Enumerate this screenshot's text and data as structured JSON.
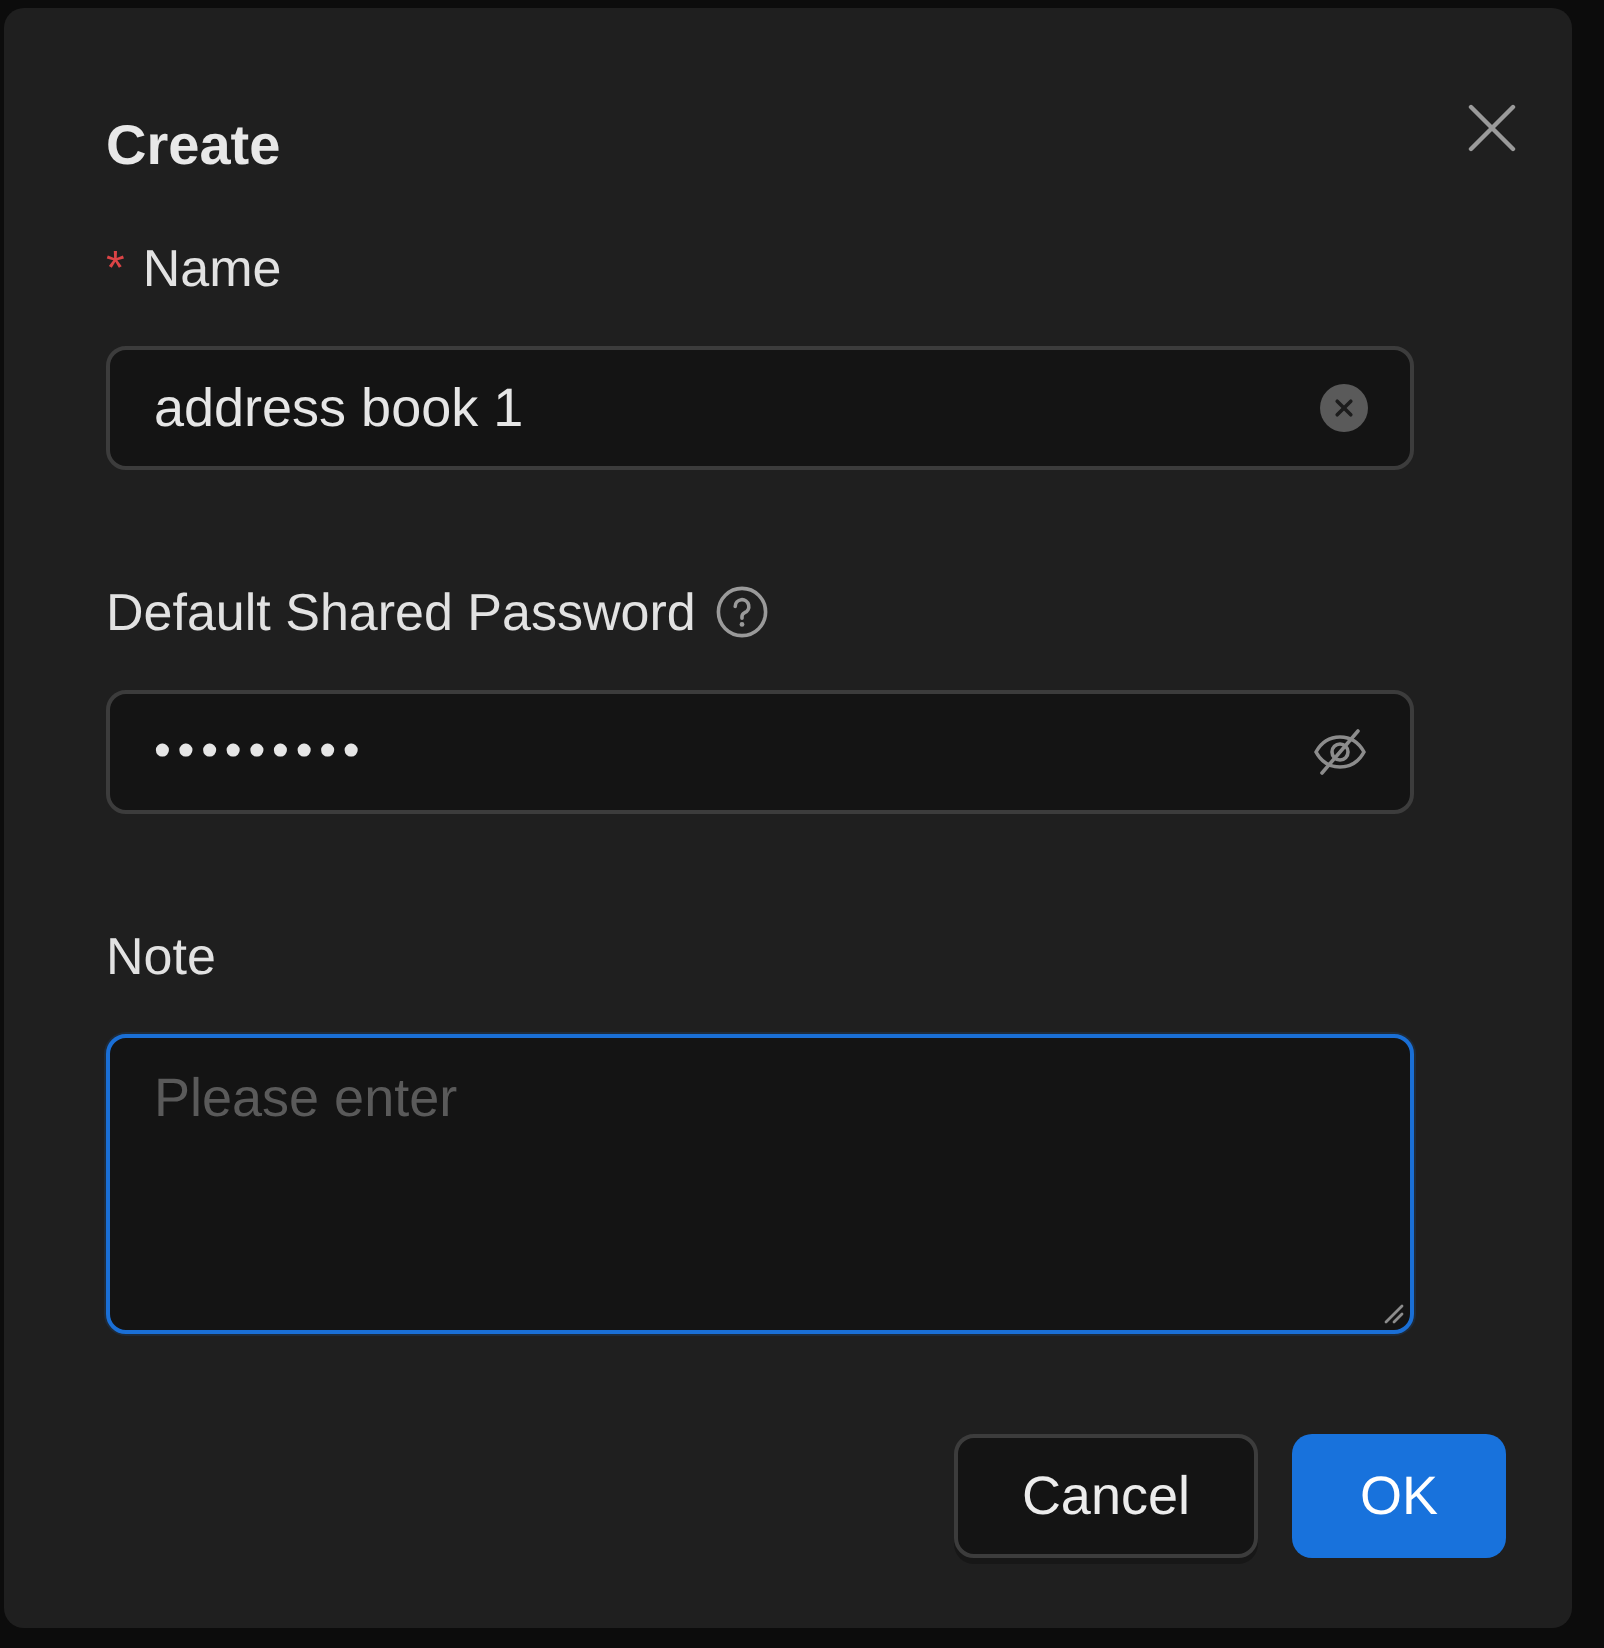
{
  "dialog": {
    "title": "Create"
  },
  "fields": [
    {
      "kind": "text",
      "label": "Name",
      "required_mark": "*",
      "value": "address book 1",
      "clearable": true,
      "focused": false
    },
    {
      "kind": "password",
      "label": "Default Shared Password",
      "help": true,
      "value": "•••••••••",
      "revealed": false,
      "focused": false
    },
    {
      "kind": "textarea",
      "label": "Note",
      "placeholder": "Please enter",
      "focused": true
    }
  ],
  "buttons": [
    {
      "label": "Cancel",
      "kind": "default"
    },
    {
      "label": "OK",
      "kind": "primary"
    }
  ]
}
